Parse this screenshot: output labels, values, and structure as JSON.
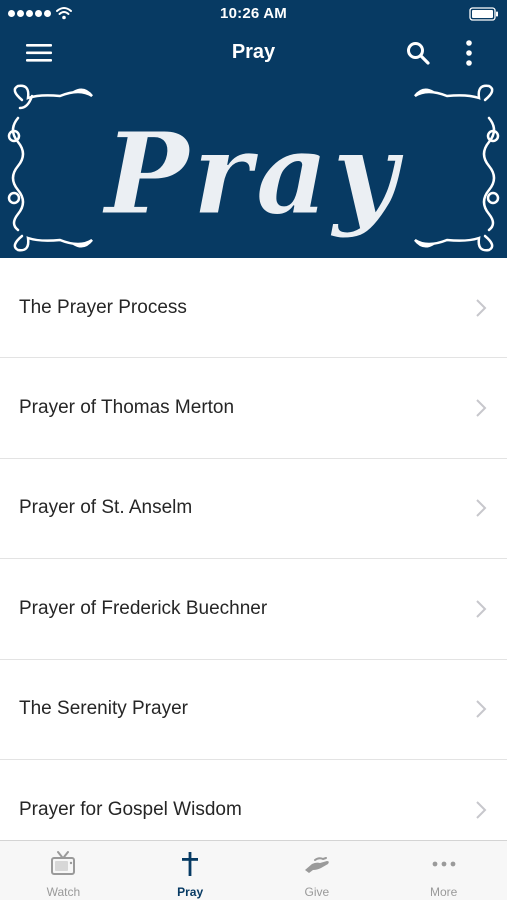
{
  "status_bar": {
    "time": "10:26 AM"
  },
  "nav": {
    "title": "Pray",
    "menu_icon": "hamburger-menu-icon",
    "search_icon": "search-icon",
    "more_icon": "vertical-dots-icon"
  },
  "banner": {
    "text": "Pray"
  },
  "list": {
    "items": [
      {
        "label": "The Prayer Process"
      },
      {
        "label": "Prayer of Thomas Merton"
      },
      {
        "label": "Prayer of St. Anselm"
      },
      {
        "label": "Prayer of Frederick Buechner"
      },
      {
        "label": "The Serenity Prayer"
      },
      {
        "label": "Prayer for Gospel Wisdom"
      }
    ]
  },
  "tabs": [
    {
      "label": "Watch",
      "icon": "tv-icon",
      "active": false
    },
    {
      "label": "Pray",
      "icon": "cross-icon",
      "active": true
    },
    {
      "label": "Give",
      "icon": "hand-icon",
      "active": false
    },
    {
      "label": "More",
      "icon": "horizontal-dots-icon",
      "active": false
    }
  ],
  "colors": {
    "header_background": "#073a63",
    "active_tab": "#073a63",
    "inactive_tab": "#9a9a9a"
  }
}
